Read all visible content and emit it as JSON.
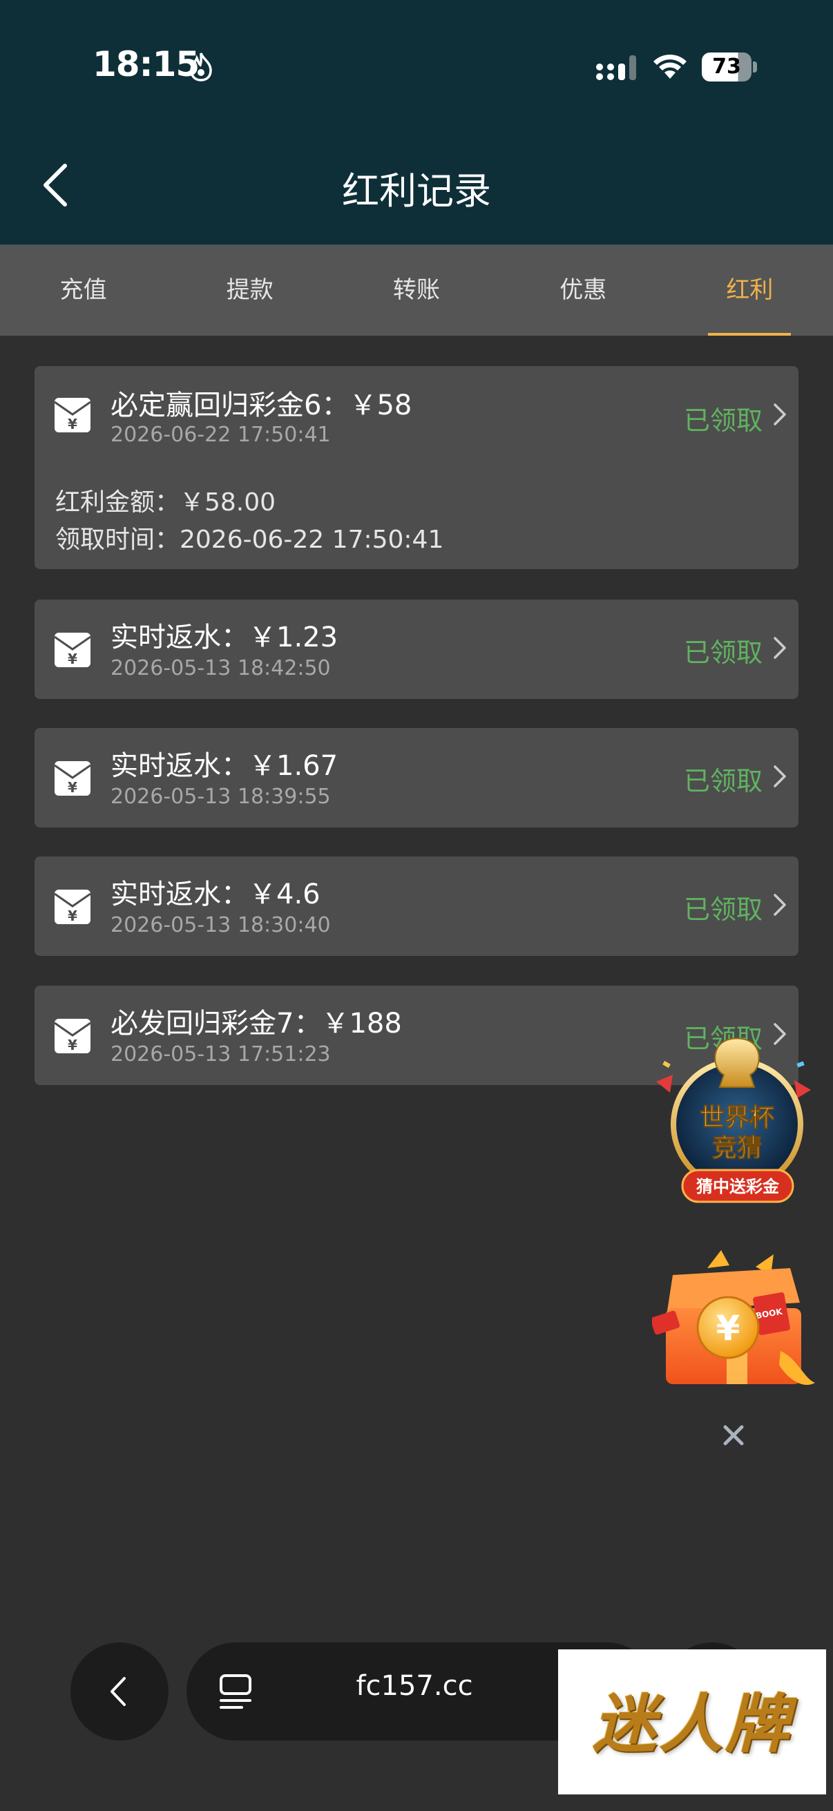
{
  "status_bar": {
    "time": "18:15",
    "battery": "73"
  },
  "header": {
    "title": "红利记录"
  },
  "tabs": [
    {
      "label": "充值"
    },
    {
      "label": "提款"
    },
    {
      "label": "转账"
    },
    {
      "label": "优惠"
    },
    {
      "label": "红利",
      "active": true
    }
  ],
  "records": [
    {
      "title": "必定赢回归彩金6：￥58",
      "date": "2026-06-22 17:50:41",
      "status": "已领取",
      "expanded": true,
      "detail_amount": "红利金额：￥58.00",
      "detail_time": "领取时间：2026-06-22 17:50:41"
    },
    {
      "title": "实时返水：￥1.23",
      "date": "2026-05-13 18:42:50",
      "status": "已领取"
    },
    {
      "title": "实时返水：￥1.67",
      "date": "2026-05-13 18:39:55",
      "status": "已领取"
    },
    {
      "title": "实时返水：￥4.6",
      "date": "2026-05-13 18:30:40",
      "status": "已领取"
    },
    {
      "title": "必发回归彩金7：￥188",
      "date": "2026-05-13 17:51:23",
      "status": "已领取"
    }
  ],
  "promo": {
    "worldcup_line1": "世界杯",
    "worldcup_line2": "竞猜",
    "worldcup_ribbon": "猜中送彩金",
    "gift_book_label": "BOOK"
  },
  "browser": {
    "url": "fc157.cc"
  },
  "watermark": {
    "text": "迷人牌"
  },
  "colors": {
    "header_bg": "#0e2f38",
    "page_bg": "#2f2f2f",
    "tab_bar_bg": "#555555",
    "active_tab": "#f0b24a",
    "card_bg": "#4d4d4d",
    "status_green": "#5fb35f"
  }
}
